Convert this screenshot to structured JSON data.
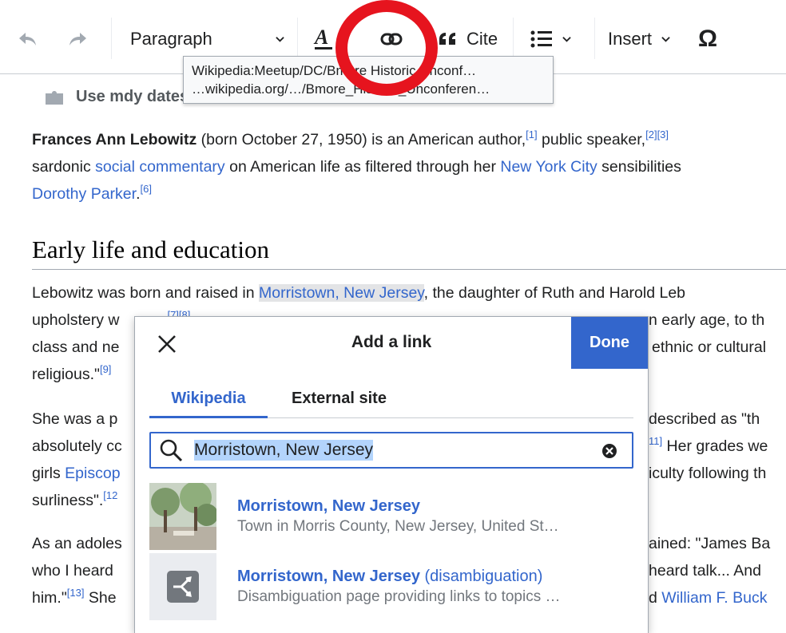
{
  "toolbar": {
    "format_label": "Paragraph",
    "cite_label": "Cite",
    "insert_label": "Insert",
    "special_char": "Ω"
  },
  "tooltip": {
    "line1": "Wikipedia:Meetup/DC/Bmore Historic Unconf…",
    "line2": "…wikipedia.org/…/Bmore_Historic_Unconferen…"
  },
  "notice": {
    "text": "Use mdy dates"
  },
  "article": {
    "p1": {
      "bold_name": "Frances Ann Lebowitz",
      "t1": " (born October 27, 1950) is an American author,",
      "ref1": "[1]",
      "t2": " public speaker,",
      "ref2": "[2][3]",
      "l2a": "sardonic ",
      "link_social": "social commentary",
      "l2b": " on American life as filtered through her ",
      "link_nyc": "New York City",
      "l2c": " sensibilities",
      "link_parker": "Dorothy Parker",
      "l3b": ".",
      "ref6": "[6]"
    },
    "heading": "Early life and education",
    "p2": {
      "t1": "Lebowitz was born and raised in ",
      "link_morristown": "Morristown, New Jersey",
      "t2": ", the daughter of Ruth and Harold Leb",
      "l2a": "upholstery w",
      "ref78": "[7][8]",
      "l2b": "n early age, to th",
      "l3a": "class and ne",
      "l3b": "ethnic or cultural",
      "l4a": "religious.\"",
      "ref9": "[9]"
    },
    "p3": {
      "l1a": "She was a p",
      "l1b": "described as \"th",
      "l2a": "absolutely cc",
      "ref11": "11]",
      "l2b": " Her grades we",
      "l3a": "girls ",
      "link_episcop": "Episcop",
      "l3b": "iculty following th",
      "l4a": "surliness\".",
      "ref12": "[12"
    },
    "p4": {
      "l1a": "As an adoles",
      "l1b": "ained: \"James Ba",
      "l2a": "who I heard",
      "l2b": "heard talk... And",
      "l3a": "him.\"",
      "ref13": "[13]",
      "l3a2": " She",
      "l3b": "d ",
      "link_buck": "William F. Buck"
    }
  },
  "dialog": {
    "title": "Add a link",
    "done_label": "Done",
    "tabs": [
      {
        "label": "Wikipedia",
        "active": true
      },
      {
        "label": "External site",
        "active": false
      }
    ],
    "search_value": "Morristown, New Jersey",
    "results": [
      {
        "title": "Morristown, New Jersey",
        "qualifier": "",
        "description": "Town in Morris County, New Jersey, United St…"
      },
      {
        "title": "Morristown, New Jersey",
        "qualifier": " (disambiguation)",
        "description": "Disambiguation page providing links to topics …"
      }
    ]
  },
  "colors": {
    "accent": "#3366cc",
    "highlight_ring": "#e6141e"
  }
}
